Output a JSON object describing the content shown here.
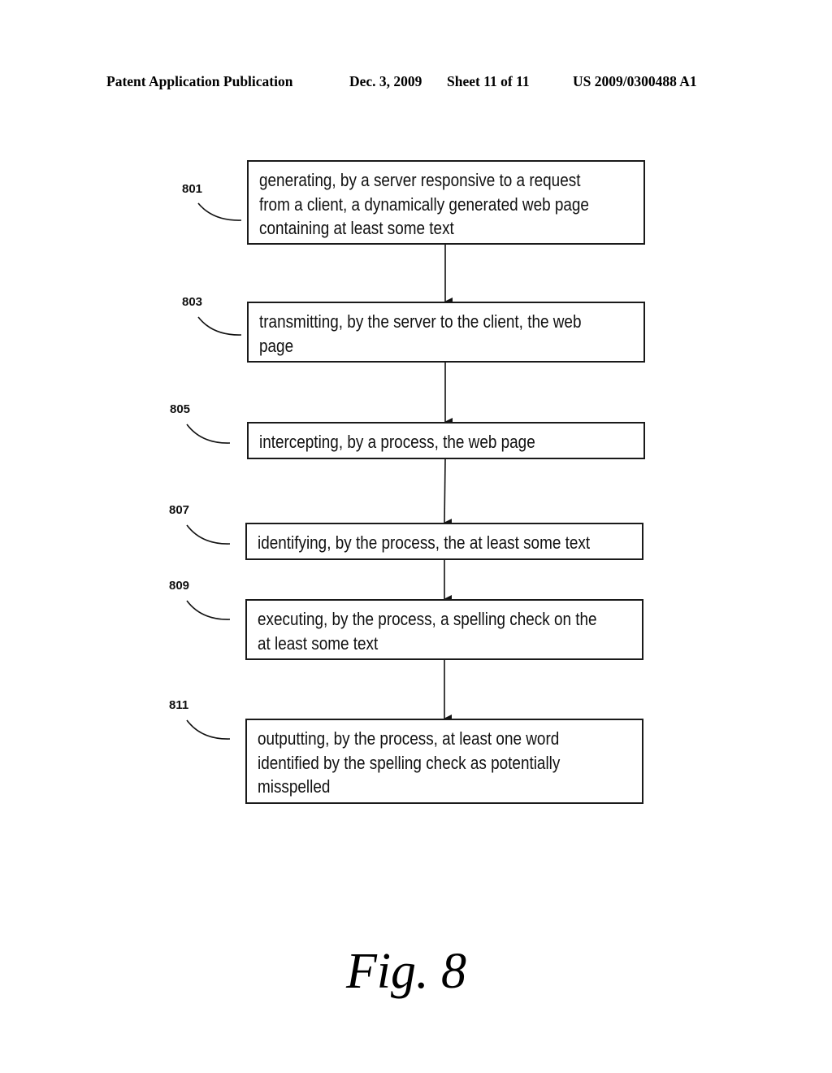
{
  "header": {
    "publication": "Patent Application Publication",
    "date": "Dec. 3, 2009",
    "sheet": "Sheet 11 of 11",
    "number": "US 2009/0300488 A1"
  },
  "steps": [
    {
      "ref": "801",
      "text": "generating, by a server responsive to a request\nfrom a client, a dynamically generated web page\ncontaining at least some text"
    },
    {
      "ref": "803",
      "text": "transmitting, by the server to the client, the web\npage"
    },
    {
      "ref": "805",
      "text": "intercepting, by a process, the web page"
    },
    {
      "ref": "807",
      "text": "identifying, by the process, the at least some text"
    },
    {
      "ref": "809",
      "text": "executing, by the process, a spelling check on the\nat least some text"
    },
    {
      "ref": "811",
      "text": "outputting, by the process, at least one word\nidentified by the spelling check as potentially\nmisspelled"
    }
  ],
  "figure_label": "Fig. 8"
}
